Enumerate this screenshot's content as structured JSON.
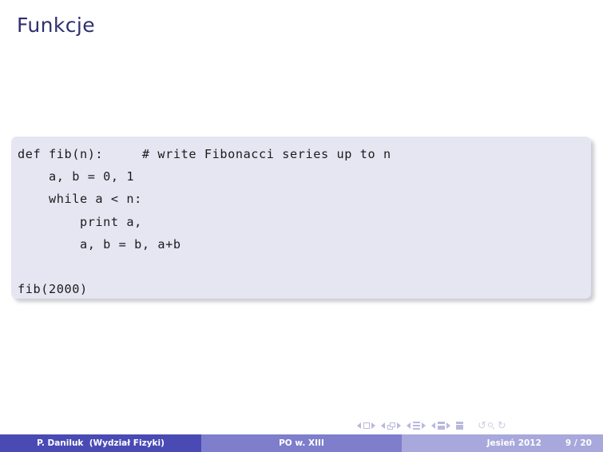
{
  "slide": {
    "title": "Funkcje",
    "title_color": "#2f2f72"
  },
  "code_block": {
    "background_color": "#e6e6f3",
    "language": "python",
    "lines": [
      "def fib(n):     # write Fibonacci series up to n",
      "    a, b = 0, 1",
      "    while a < n:",
      "        print a,",
      "        a, b = b, a+b",
      "",
      "fib(2000)"
    ],
    "text": "def fib(n):     # write Fibonacci series up to n\n    a, b = 0, 1\n    while a < n:\n        print a,\n        a, b = b, a+b\n\nfib(2000)"
  },
  "nav_symbols": {
    "groups": [
      {
        "icon": "slide-nav-square"
      },
      {
        "icon": "slide-nav-frames"
      },
      {
        "icon": "slide-nav-subsection"
      },
      {
        "icon": "slide-nav-section"
      }
    ],
    "extra": [
      {
        "icon": "presentation-icon"
      },
      {
        "icon": "back-circle-icon"
      },
      {
        "icon": "magnifier-icon"
      },
      {
        "icon": "forward-circle-icon"
      }
    ]
  },
  "footer": {
    "author": "P. Daniluk  (Wydział Fizyki)",
    "title": "PO w. XIII",
    "date": "Jesień 2012",
    "page": "9 / 20",
    "colors": {
      "author_bg": "#4a4ab4",
      "title_bg": "#7e7ecd",
      "right_bg": "#a8a8dc"
    }
  }
}
